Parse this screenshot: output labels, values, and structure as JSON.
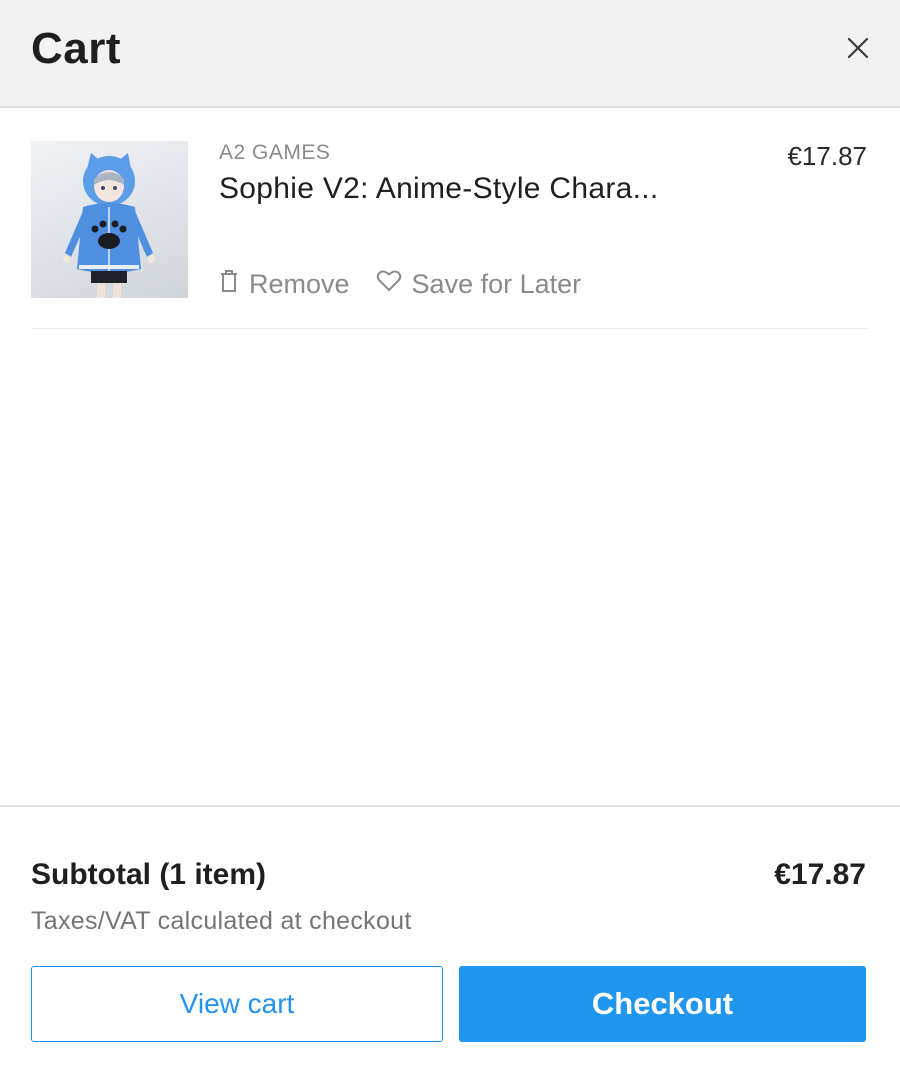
{
  "header": {
    "title": "Cart",
    "close_icon": "close-icon"
  },
  "cart": {
    "items": [
      {
        "vendor": "A2 GAMES",
        "name": "Sophie V2: Anime-Style Chara...",
        "price": "€17.87",
        "thumbnail_icon": "anime-character-thumbnail",
        "remove_label": "Remove",
        "remove_icon": "trash-icon",
        "save_label": "Save for Later",
        "save_icon": "heart-icon"
      }
    ]
  },
  "footer": {
    "subtotal_label": "Subtotal (1 item)",
    "subtotal_value": "€17.87",
    "tax_note": "Taxes/VAT calculated at checkout",
    "view_cart_label": "View cart",
    "checkout_label": "Checkout"
  },
  "colors": {
    "accent": "#2196ef",
    "header_bg": "#f2f2f2",
    "muted_text": "#8a8a8a"
  }
}
